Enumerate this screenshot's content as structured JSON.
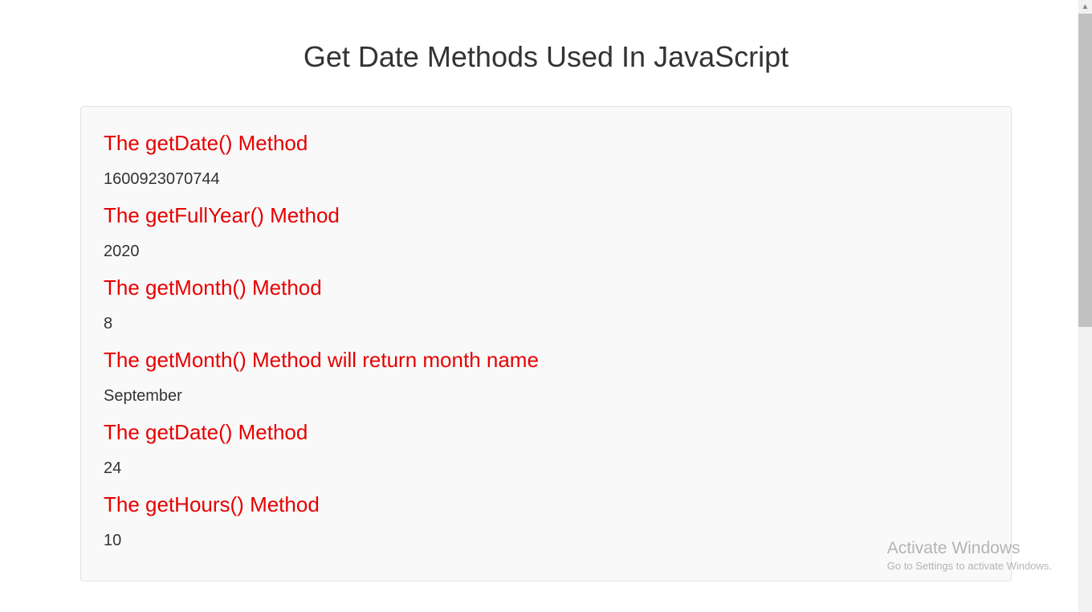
{
  "page": {
    "title": "Get Date Methods Used In JavaScript"
  },
  "sections": [
    {
      "heading": "The getDate() Method",
      "value": "1600923070744"
    },
    {
      "heading": "The getFullYear() Method",
      "value": "2020"
    },
    {
      "heading": "The getMonth() Method",
      "value": "8"
    },
    {
      "heading": "The getMonth() Method will return month name",
      "value": "September"
    },
    {
      "heading": "The getDate() Method",
      "value": "24"
    },
    {
      "heading": "The getHours() Method",
      "value": "10"
    }
  ],
  "watermark": {
    "title": "Activate Windows",
    "subtitle": "Go to Settings to activate Windows."
  }
}
